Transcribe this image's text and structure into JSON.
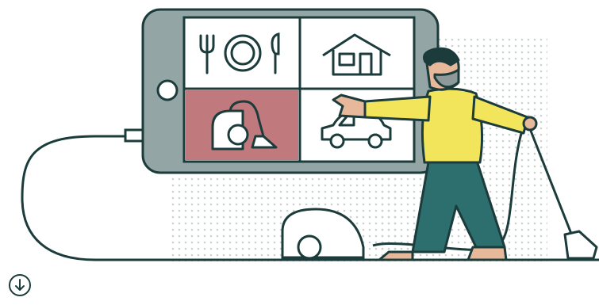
{
  "illustration": {
    "description_icons": [
      "fork-knife-plate-icon",
      "house-icon",
      "vacuum-cleaner-icon",
      "car-icon"
    ],
    "colors": {
      "outline": "#1c3b3b",
      "phone_frame": "#94a5a5",
      "tile_bg": "#ffffff",
      "tile_highlight": "#c07a7d",
      "dots": "#c9d1d1",
      "shirt": "#f2e55b",
      "pants": "#2d6e6e",
      "skin": "#e7b99a",
      "hair": "#8e9a9a"
    }
  },
  "scroll_button": {
    "icon": "arrow-down-circle-icon",
    "color": "#1c3b3b"
  }
}
